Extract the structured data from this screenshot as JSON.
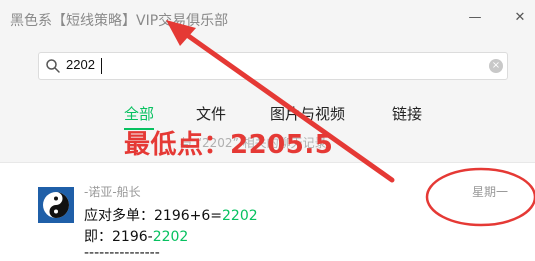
{
  "window": {
    "title": "黑色系【短线策略】VIP交易俱乐部",
    "minimize_label": "—",
    "close_label": "✕"
  },
  "search": {
    "value": "2202",
    "clear_label": "×"
  },
  "tabs": [
    {
      "label": "全部",
      "active": true
    },
    {
      "label": "文件",
      "active": false
    },
    {
      "label": "图片与视频",
      "active": false
    },
    {
      "label": "链接",
      "active": false
    }
  ],
  "hint": "与 “2202” 相关的聊天记录",
  "annotation": {
    "text": "最低点：2205.5",
    "color": "#e53935"
  },
  "message": {
    "sender": "-诺亚-船长",
    "line1_prefix": "应对多单：2196+6=",
    "line1_highlight": "2202",
    "line2_prefix": "即：2196-",
    "line2_highlight": "2202",
    "line3": "---------------",
    "date": "星期一"
  },
  "colors": {
    "accent_green": "#07c160",
    "annotation_red": "#e53935"
  }
}
